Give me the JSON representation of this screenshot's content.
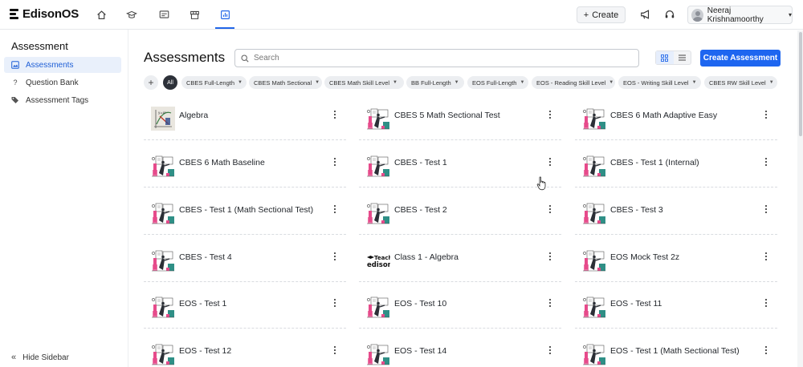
{
  "app": {
    "name": "EdisonOS"
  },
  "topbar": {
    "nav_icons": [
      "home-icon",
      "graduation-cap-icon",
      "id-card-icon",
      "store-icon",
      "chart-icon"
    ],
    "create_label": "Create",
    "user_name": "Neeraj Krishnamoorthy"
  },
  "sidebar": {
    "title": "Assessment",
    "items": [
      {
        "label": "Assessments",
        "icon": "image-icon",
        "active": true
      },
      {
        "label": "Question Bank",
        "icon": "question-icon",
        "active": false
      },
      {
        "label": "Assessment Tags",
        "icon": "tags-icon",
        "active": false
      }
    ],
    "hide_label": "Hide Sidebar"
  },
  "main": {
    "title": "Assessments",
    "search_placeholder": "Search",
    "create_button": "Create Assessment",
    "all_chip": "All",
    "filters": [
      "CBES Full-Length",
      "CBES Math Sectional",
      "CBES Math Skill Level",
      "BB Full-Length",
      "EOS Full-Length",
      "EOS - Reading Skill Level",
      "EOS - Writing Skill Level",
      "CBES RW Skill Level"
    ],
    "cards": [
      {
        "title": "Algebra",
        "thumb": "algebra"
      },
      {
        "title": "CBES 5 Math Sectional Test",
        "thumb": "illustration"
      },
      {
        "title": "CBES 6 Math Adaptive Easy",
        "thumb": "illustration"
      },
      {
        "title": "CBES 6 Math Baseline",
        "thumb": "illustration"
      },
      {
        "title": "CBES - Test 1",
        "thumb": "illustration"
      },
      {
        "title": "CBES - Test 1 (Internal)",
        "thumb": "illustration"
      },
      {
        "title": "CBES - Test 1 (Math Sectional Test)",
        "thumb": "illustration"
      },
      {
        "title": "CBES - Test 2",
        "thumb": "illustration"
      },
      {
        "title": "CBES - Test 3",
        "thumb": "illustration"
      },
      {
        "title": "CBES - Test 4",
        "thumb": "illustration"
      },
      {
        "title": "Class 1 - Algebra",
        "thumb": "teachedison"
      },
      {
        "title": "EOS Mock Test 2z",
        "thumb": "illustration"
      },
      {
        "title": "EOS - Test 1",
        "thumb": "illustration"
      },
      {
        "title": "EOS - Test 10",
        "thumb": "illustration"
      },
      {
        "title": "EOS - Test 11",
        "thumb": "illustration"
      },
      {
        "title": "EOS - Test 12",
        "thumb": "illustration"
      },
      {
        "title": "EOS - Test 14",
        "thumb": "illustration"
      },
      {
        "title": "EOS - Test 1 (Math Sectional Test)",
        "thumb": "illustration"
      }
    ],
    "thumb_logo_text": [
      "Teach",
      "edison"
    ]
  },
  "colors": {
    "accent": "#1e66f0",
    "active_bg": "#e9f0fb",
    "thumb_pink": "#e64b8b",
    "thumb_teal": "#2f8f86"
  }
}
